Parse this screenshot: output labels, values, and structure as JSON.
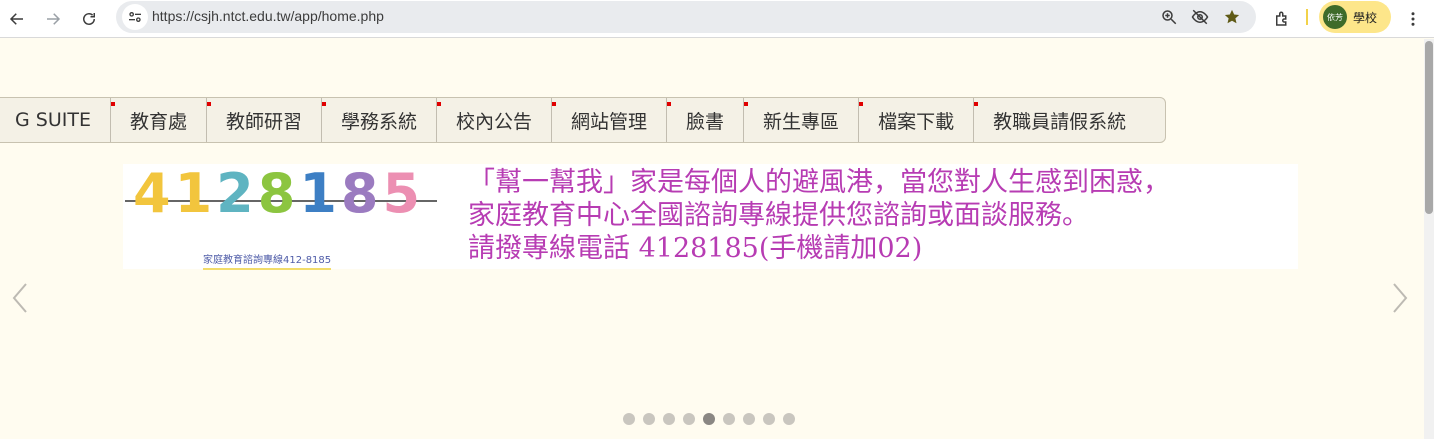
{
  "browser": {
    "url": "https://csjh.ntct.edu.tw/app/home.php",
    "profile_label": "學校",
    "avatar_text": "依芳"
  },
  "nav": {
    "items": [
      {
        "label": "G SUITE",
        "marker": false
      },
      {
        "label": "教育處",
        "marker": true
      },
      {
        "label": "教師研習",
        "marker": true
      },
      {
        "label": "學務系統",
        "marker": true
      },
      {
        "label": "校內公告",
        "marker": true
      },
      {
        "label": "網站管理",
        "marker": true
      },
      {
        "label": "臉書",
        "marker": true
      },
      {
        "label": "新生專區",
        "marker": true
      },
      {
        "label": "檔案下載",
        "marker": true
      },
      {
        "label": "教職員請假系統",
        "marker": true
      }
    ]
  },
  "banner": {
    "digits": [
      "4",
      "1",
      "2",
      "8",
      "1",
      "8",
      "5"
    ],
    "digit_colors": [
      "#f2c53d",
      "#f2c53d",
      "#5fb4c1",
      "#8cc540",
      "#3d7fc4",
      "#9b7bc0",
      "#ec8fb2"
    ],
    "caption": "家庭教育諮詢專線412-8185",
    "lines": [
      "「幫一幫我」家是每個人的避風港，當您對人生感到困惑，",
      "家庭教育中心全國諮詢專線提供您諮詢或面談服務。",
      "請撥專線電話 4128185(手機請加02)"
    ]
  },
  "carousel": {
    "slide_count": 9,
    "active_index": 4
  }
}
